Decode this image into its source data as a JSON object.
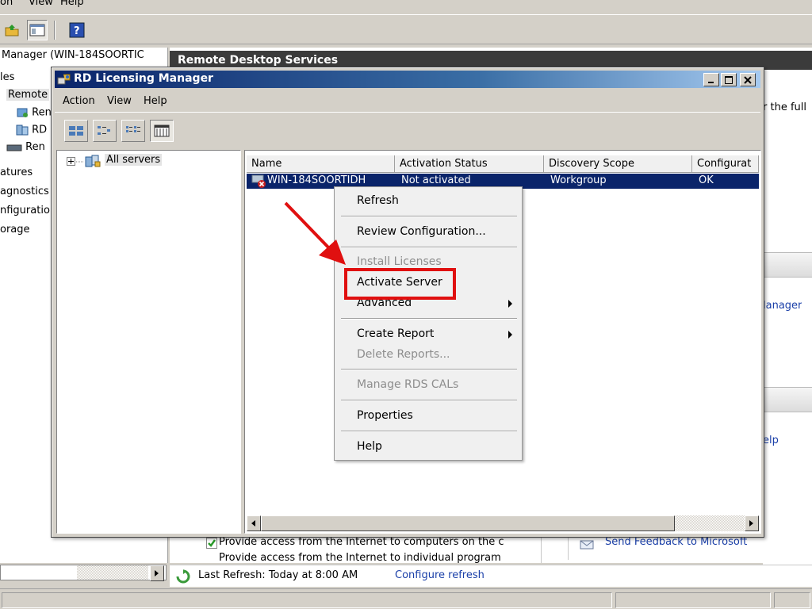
{
  "bg": {
    "menu": [
      "on",
      "View",
      "Help"
    ],
    "tree": {
      "root": "Manager (WIN-184SOORTIC",
      "roles": "les",
      "remote": "Remote",
      "rem1": "Ren",
      "rd": "RD",
      "rem2": "Ren",
      "features": "atures",
      "diagnostics": "agnostics",
      "configuration": "nfiguratio",
      "storage": "orage"
    },
    "header_title": "Remote Desktop Services",
    "actions": {
      "full_text": "r the full",
      "manager_link": "lanager",
      "help_link": "elp",
      "feedback_link": "Send Feedback to Microsoft"
    },
    "content_lines": [
      "Provide access from the Internet to computers on the c",
      "Provide access from the Internet to individual program"
    ],
    "last_refresh": "Last Refresh: Today at 8:00 AM",
    "configure_refresh": "Configure refresh"
  },
  "rdlm": {
    "title": "RD Licensing Manager",
    "menu": [
      "Action",
      "View",
      "Help"
    ],
    "tree_root": "All servers",
    "columns": [
      "Name",
      "Activation Status",
      "Discovery Scope",
      "Configurat"
    ],
    "row": {
      "name": "WIN-184SOORTIDH",
      "activation_status": "Not activated",
      "discovery_scope": "Workgroup",
      "configuration": "OK"
    }
  },
  "context_menu": {
    "refresh": "Refresh",
    "review": "Review Configuration...",
    "install": "Install Licenses",
    "activate": "Activate Server",
    "advanced": "Advanced",
    "create_report": "Create Report",
    "delete_reports": "Delete Reports...",
    "manage_cals": "Manage RDS CALs",
    "properties": "Properties",
    "help": "Help"
  },
  "colors": {
    "highlight": "#e01010",
    "selection": "#0a246a",
    "link": "#1a3fa8"
  }
}
